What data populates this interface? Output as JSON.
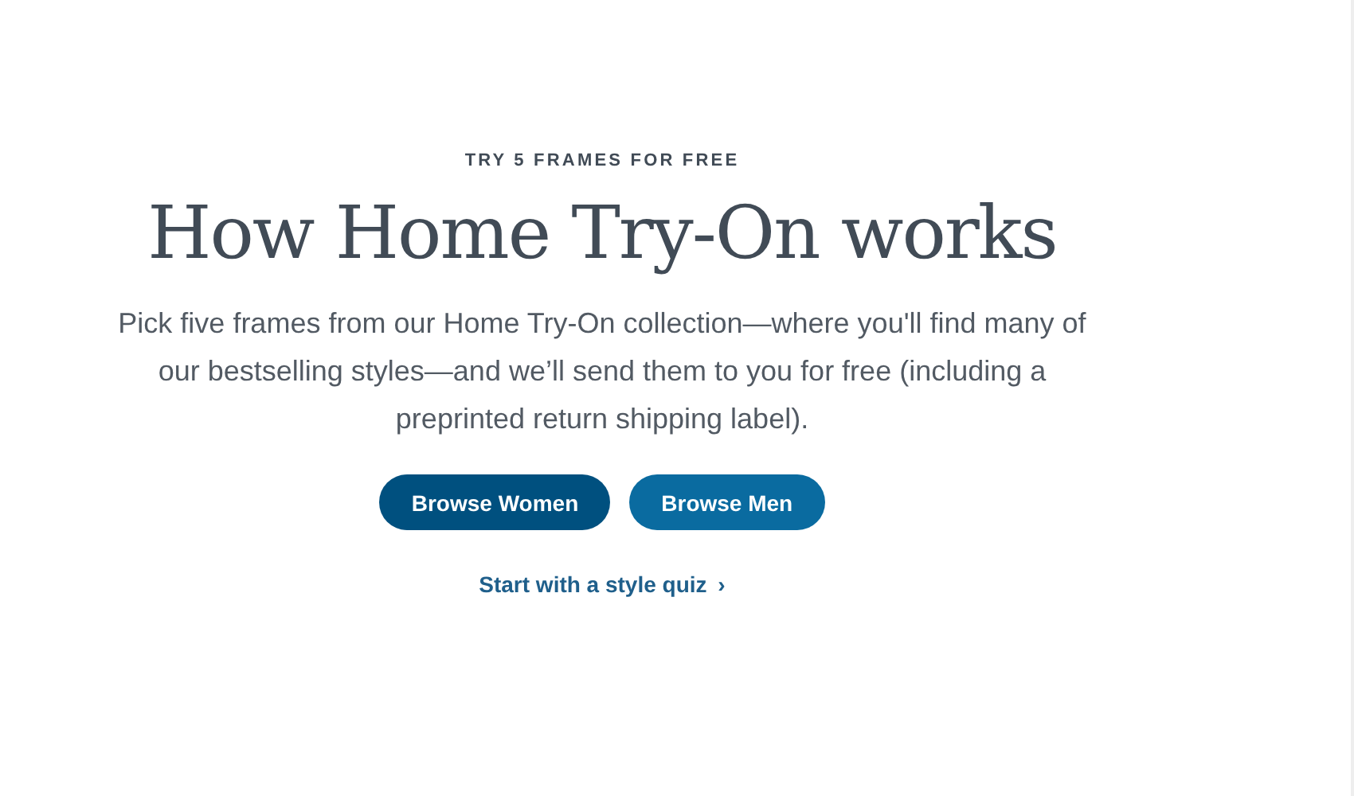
{
  "eyebrow": "TRY 5 FRAMES FOR FREE",
  "title": "How Home Try-On works",
  "description": "Pick five frames from our Home Try-On collection—where you'll find many of our bestselling styles—and we’ll send them to you for free (including a preprinted return shipping label).",
  "buttons": [
    "Browse Women",
    "Browse Men"
  ],
  "link": {
    "label": "Start with a style quiz",
    "icon": "›"
  }
}
